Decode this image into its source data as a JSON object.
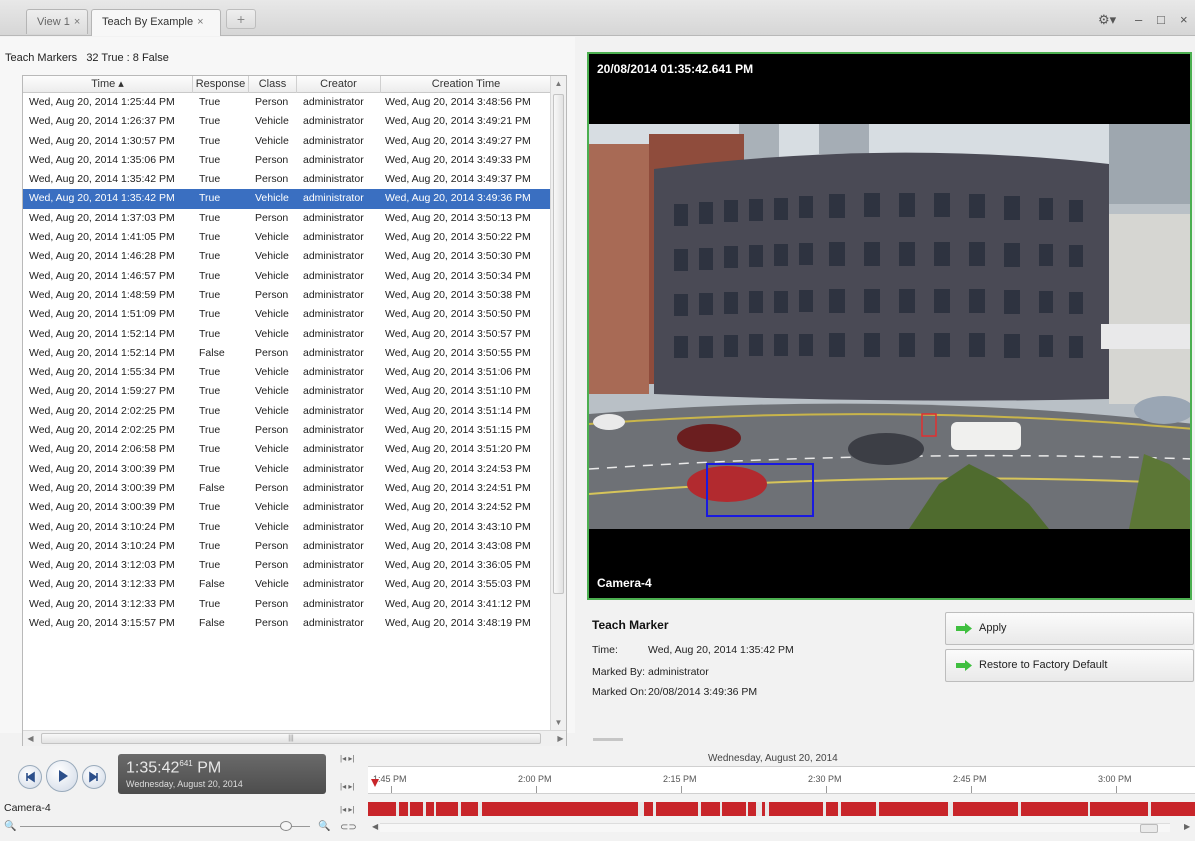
{
  "tabs": [
    {
      "label": "View 1",
      "close": "×"
    },
    {
      "label": "Teach By Example",
      "close": "×"
    }
  ],
  "tab_add": "+",
  "window_controls": {
    "settings": "⚙▾",
    "minimize": "–",
    "maximize": "□",
    "close": "×"
  },
  "teach_markers": {
    "title": "Teach Markers",
    "summary": "32 True : 8 False",
    "columns": [
      "Time ▴",
      "Response",
      "Class",
      "Creator",
      "Creation Time"
    ],
    "rows": [
      {
        "time": "Wed, Aug 20, 2014 1:25:44 PM",
        "response": "True",
        "class": "Person",
        "creator": "administrator",
        "creation_time": "Wed, Aug 20, 2014 3:48:56 PM"
      },
      {
        "time": "Wed, Aug 20, 2014 1:26:37 PM",
        "response": "True",
        "class": "Vehicle",
        "creator": "administrator",
        "creation_time": "Wed, Aug 20, 2014 3:49:21 PM"
      },
      {
        "time": "Wed, Aug 20, 2014 1:30:57 PM",
        "response": "True",
        "class": "Vehicle",
        "creator": "administrator",
        "creation_time": "Wed, Aug 20, 2014 3:49:27 PM"
      },
      {
        "time": "Wed, Aug 20, 2014 1:35:06 PM",
        "response": "True",
        "class": "Person",
        "creator": "administrator",
        "creation_time": "Wed, Aug 20, 2014 3:49:33 PM"
      },
      {
        "time": "Wed, Aug 20, 2014 1:35:42 PM",
        "response": "True",
        "class": "Person",
        "creator": "administrator",
        "creation_time": "Wed, Aug 20, 2014 3:49:37 PM"
      },
      {
        "time": "Wed, Aug 20, 2014 1:35:42 PM",
        "response": "True",
        "class": "Vehicle",
        "creator": "administrator",
        "creation_time": "Wed, Aug 20, 2014 3:49:36 PM",
        "selected": true
      },
      {
        "time": "Wed, Aug 20, 2014 1:37:03 PM",
        "response": "True",
        "class": "Person",
        "creator": "administrator",
        "creation_time": "Wed, Aug 20, 2014 3:50:13 PM"
      },
      {
        "time": "Wed, Aug 20, 2014 1:41:05 PM",
        "response": "True",
        "class": "Vehicle",
        "creator": "administrator",
        "creation_time": "Wed, Aug 20, 2014 3:50:22 PM"
      },
      {
        "time": "Wed, Aug 20, 2014 1:46:28 PM",
        "response": "True",
        "class": "Vehicle",
        "creator": "administrator",
        "creation_time": "Wed, Aug 20, 2014 3:50:30 PM"
      },
      {
        "time": "Wed, Aug 20, 2014 1:46:57 PM",
        "response": "True",
        "class": "Vehicle",
        "creator": "administrator",
        "creation_time": "Wed, Aug 20, 2014 3:50:34 PM"
      },
      {
        "time": "Wed, Aug 20, 2014 1:48:59 PM",
        "response": "True",
        "class": "Person",
        "creator": "administrator",
        "creation_time": "Wed, Aug 20, 2014 3:50:38 PM"
      },
      {
        "time": "Wed, Aug 20, 2014 1:51:09 PM",
        "response": "True",
        "class": "Vehicle",
        "creator": "administrator",
        "creation_time": "Wed, Aug 20, 2014 3:50:50 PM"
      },
      {
        "time": "Wed, Aug 20, 2014 1:52:14 PM",
        "response": "True",
        "class": "Vehicle",
        "creator": "administrator",
        "creation_time": "Wed, Aug 20, 2014 3:50:57 PM"
      },
      {
        "time": "Wed, Aug 20, 2014 1:52:14 PM",
        "response": "False",
        "class": "Person",
        "creator": "administrator",
        "creation_time": "Wed, Aug 20, 2014 3:50:55 PM"
      },
      {
        "time": "Wed, Aug 20, 2014 1:55:34 PM",
        "response": "True",
        "class": "Vehicle",
        "creator": "administrator",
        "creation_time": "Wed, Aug 20, 2014 3:51:06 PM"
      },
      {
        "time": "Wed, Aug 20, 2014 1:59:27 PM",
        "response": "True",
        "class": "Vehicle",
        "creator": "administrator",
        "creation_time": "Wed, Aug 20, 2014 3:51:10 PM"
      },
      {
        "time": "Wed, Aug 20, 2014 2:02:25 PM",
        "response": "True",
        "class": "Vehicle",
        "creator": "administrator",
        "creation_time": "Wed, Aug 20, 2014 3:51:14 PM"
      },
      {
        "time": "Wed, Aug 20, 2014 2:02:25 PM",
        "response": "True",
        "class": "Person",
        "creator": "administrator",
        "creation_time": "Wed, Aug 20, 2014 3:51:15 PM"
      },
      {
        "time": "Wed, Aug 20, 2014 2:06:58 PM",
        "response": "True",
        "class": "Vehicle",
        "creator": "administrator",
        "creation_time": "Wed, Aug 20, 2014 3:51:20 PM"
      },
      {
        "time": "Wed, Aug 20, 2014 3:00:39 PM",
        "response": "True",
        "class": "Vehicle",
        "creator": "administrator",
        "creation_time": "Wed, Aug 20, 2014 3:24:53 PM"
      },
      {
        "time": "Wed, Aug 20, 2014 3:00:39 PM",
        "response": "False",
        "class": "Person",
        "creator": "administrator",
        "creation_time": "Wed, Aug 20, 2014 3:24:51 PM"
      },
      {
        "time": "Wed, Aug 20, 2014 3:00:39 PM",
        "response": "True",
        "class": "Vehicle",
        "creator": "administrator",
        "creation_time": "Wed, Aug 20, 2014 3:24:52 PM"
      },
      {
        "time": "Wed, Aug 20, 2014 3:10:24 PM",
        "response": "True",
        "class": "Vehicle",
        "creator": "administrator",
        "creation_time": "Wed, Aug 20, 2014 3:43:10 PM"
      },
      {
        "time": "Wed, Aug 20, 2014 3:10:24 PM",
        "response": "True",
        "class": "Person",
        "creator": "administrator",
        "creation_time": "Wed, Aug 20, 2014 3:43:08 PM"
      },
      {
        "time": "Wed, Aug 20, 2014 3:12:03 PM",
        "response": "True",
        "class": "Person",
        "creator": "administrator",
        "creation_time": "Wed, Aug 20, 2014 3:36:05 PM"
      },
      {
        "time": "Wed, Aug 20, 2014 3:12:33 PM",
        "response": "False",
        "class": "Vehicle",
        "creator": "administrator",
        "creation_time": "Wed, Aug 20, 2014 3:55:03 PM"
      },
      {
        "time": "Wed, Aug 20, 2014 3:12:33 PM",
        "response": "True",
        "class": "Person",
        "creator": "administrator",
        "creation_time": "Wed, Aug 20, 2014 3:41:12 PM"
      },
      {
        "time": "Wed, Aug 20, 2014 3:15:57 PM",
        "response": "False",
        "class": "Person",
        "creator": "administrator",
        "creation_time": "Wed, Aug 20, 2014 3:48:19 PM"
      }
    ]
  },
  "video": {
    "timestamp": "20/08/2014 01:35:42.641 PM",
    "camera": "Camera-4",
    "border_color": "#4caf50",
    "box_color": "#1a1ae0"
  },
  "teach_marker": {
    "title": "Teach Marker",
    "time_label": "Time:",
    "time_value": "Wed, Aug 20, 2014 1:35:42 PM",
    "marked_by_label": "Marked By:",
    "marked_by_value": "administrator",
    "marked_on_label": "Marked On:",
    "marked_on_value": "20/08/2014 3:49:36 PM"
  },
  "buttons": {
    "apply": "Apply",
    "restore": "Restore to Factory Default"
  },
  "playback": {
    "time": "1:35:42",
    "ms": "641",
    "ampm": "PM",
    "date": "Wednesday, August 20, 2014"
  },
  "timeline": {
    "date": "Wednesday, August 20, 2014",
    "ticks": [
      "1:45 PM",
      "2:00 PM",
      "2:15 PM",
      "2:30 PM",
      "2:45 PM",
      "3:00 PM"
    ],
    "camera": "Camera-4",
    "record_color": "#c8252a"
  }
}
